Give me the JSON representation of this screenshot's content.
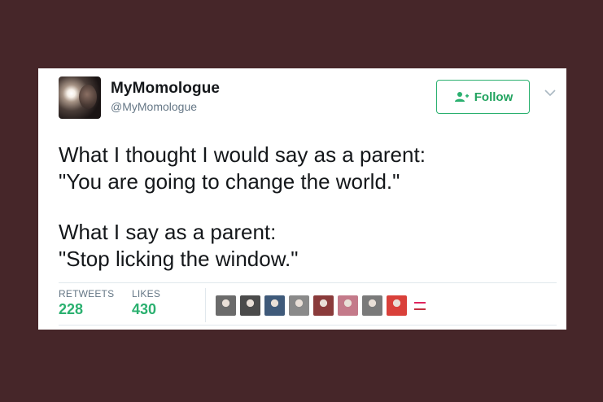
{
  "tweet": {
    "display_name": "MyMomologue",
    "handle": "@MyMomologue",
    "follow_label": "Follow",
    "text_lines": [
      "What I thought I would say as a parent:",
      "\"You are going to change the world.\"",
      "What I say as a parent:",
      "\"Stop licking the window.\""
    ]
  },
  "stats": {
    "retweets_label": "RETWEETS",
    "retweets_value": "228",
    "likes_label": "LIKES",
    "likes_value": "430"
  },
  "liked_by": [
    {
      "icon": "avatar-icon",
      "color": "#6b6b6b"
    },
    {
      "icon": "avatar-icon",
      "color": "#4b4b4b"
    },
    {
      "icon": "avatar-icon",
      "color": "#3f5a7a"
    },
    {
      "icon": "avatar-icon",
      "color": "#8a8a8a"
    },
    {
      "icon": "avatar-icon",
      "color": "#8a3b3b"
    },
    {
      "icon": "avatar-icon",
      "color": "#c47a8a"
    },
    {
      "icon": "avatar-icon",
      "color": "#7a7a7a"
    },
    {
      "icon": "avatar-icon",
      "color": "#d9403a"
    }
  ],
  "colors": {
    "page_background": "#462629",
    "card_background": "#ffffff",
    "accent_green": "#2ab06f",
    "text_primary": "#14171a",
    "text_secondary": "#657786"
  }
}
